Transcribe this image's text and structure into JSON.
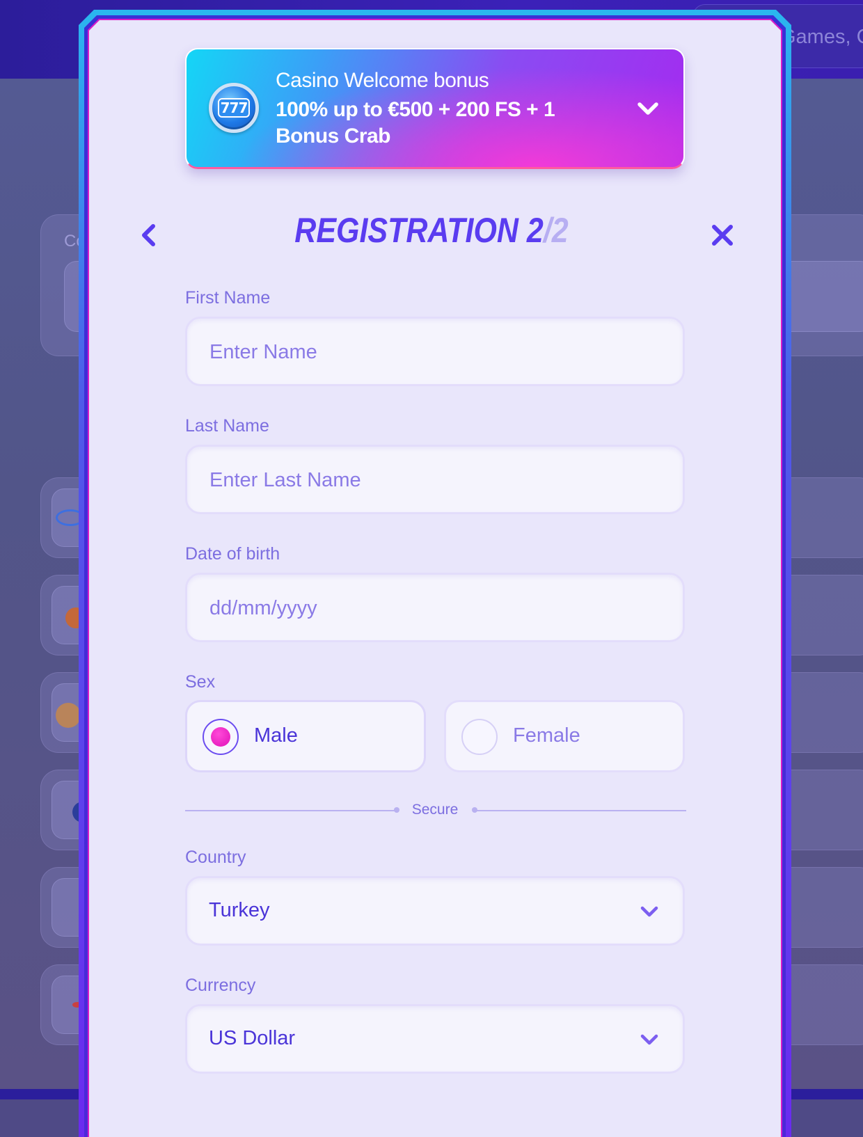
{
  "background": {
    "search_placeholder": "Games, Categories",
    "card_label": "Co"
  },
  "bonus": {
    "icon": "slot-777-icon",
    "icon_text": "777",
    "title": "Casino Welcome bonus",
    "offer": "100% up to €500 + 200 FS + 1 Bonus Crab"
  },
  "header": {
    "title_main": "REGISTRATION 2",
    "title_sep": "/",
    "title_total": "2"
  },
  "form": {
    "first_name": {
      "label": "First Name",
      "placeholder": "Enter Name",
      "value": ""
    },
    "last_name": {
      "label": "Last Name",
      "placeholder": "Enter Last Name",
      "value": ""
    },
    "dob": {
      "label": "Date of birth",
      "placeholder": "dd/mm/yyyy",
      "value": ""
    },
    "sex": {
      "label": "Sex",
      "options": [
        {
          "label": "Male",
          "selected": true
        },
        {
          "label": "Female",
          "selected": false
        }
      ]
    },
    "divider": "Secure",
    "country": {
      "label": "Country",
      "value": "Turkey"
    },
    "currency": {
      "label": "Currency",
      "value": "US Dollar"
    }
  },
  "colors": {
    "accent": "#5a3cf0",
    "label": "#7c6ee0",
    "radio_selected": "#e011b8",
    "modal_bg": "#e9e6fb"
  }
}
